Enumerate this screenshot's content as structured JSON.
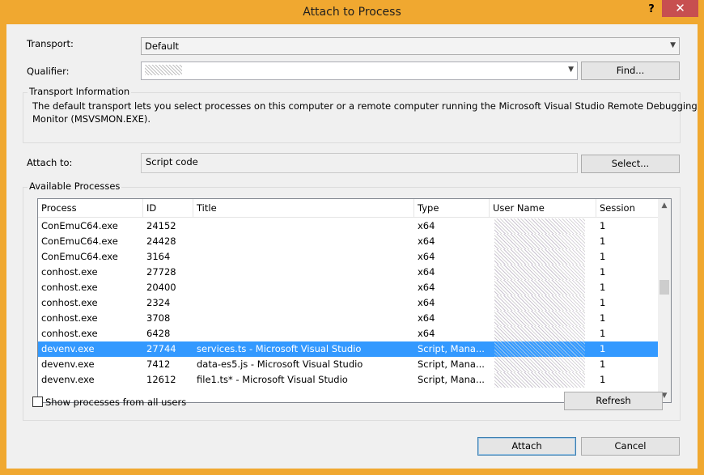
{
  "window": {
    "title": "Attach to Process",
    "help_glyph": "?",
    "close_glyph": "✕"
  },
  "transport": {
    "label": "Transport:",
    "value": "Default"
  },
  "qualifier": {
    "label": "Qualifier:",
    "value": "",
    "find_label": "Find..."
  },
  "transport_info": {
    "title": "Transport Information",
    "text_line1": "The default transport lets you select processes on this computer or a remote computer running the Microsoft Visual Studio Remote Debugging",
    "text_line2": "Monitor (MSVSMON.EXE)."
  },
  "attach_to": {
    "label": "Attach to:",
    "value": "Script code",
    "select_label": "Select..."
  },
  "processes": {
    "title": "Available Processes",
    "columns": [
      "Process",
      "ID",
      "Title",
      "Type",
      "User Name",
      "Session"
    ],
    "rows": [
      {
        "process": "ConEmuC64.exe",
        "id": "24152",
        "title": "",
        "type": "x64",
        "session": "1"
      },
      {
        "process": "ConEmuC64.exe",
        "id": "24428",
        "title": "",
        "type": "x64",
        "session": "1"
      },
      {
        "process": "ConEmuC64.exe",
        "id": "3164",
        "title": "",
        "type": "x64",
        "session": "1"
      },
      {
        "process": "conhost.exe",
        "id": "27728",
        "title": "",
        "type": "x64",
        "session": "1"
      },
      {
        "process": "conhost.exe",
        "id": "20400",
        "title": "",
        "type": "x64",
        "session": "1"
      },
      {
        "process": "conhost.exe",
        "id": "2324",
        "title": "",
        "type": "x64",
        "session": "1"
      },
      {
        "process": "conhost.exe",
        "id": "3708",
        "title": "",
        "type": "x64",
        "session": "1"
      },
      {
        "process": "conhost.exe",
        "id": "6428",
        "title": "",
        "type": "x64",
        "session": "1"
      },
      {
        "process": "devenv.exe",
        "id": "27744",
        "title": "services.ts - Microsoft Visual Studio",
        "type": "Script, Mana...",
        "session": "1"
      },
      {
        "process": "devenv.exe",
        "id": "7412",
        "title": "data-es5.js - Microsoft Visual Studio",
        "type": "Script, Mana...",
        "session": "1"
      },
      {
        "process": "devenv.exe",
        "id": "12612",
        "title": "file1.ts* - Microsoft Visual Studio",
        "type": "Script, Mana...",
        "session": "1"
      }
    ],
    "selected_index": 8,
    "show_all_label": "Show processes from all users",
    "show_all_checked": false,
    "refresh_label": "Refresh"
  },
  "footer": {
    "attach_label": "Attach",
    "cancel_label": "Cancel"
  },
  "colors": {
    "title_bar": "#f0a830",
    "close_button": "#c74f50",
    "selection": "#3399ff"
  }
}
